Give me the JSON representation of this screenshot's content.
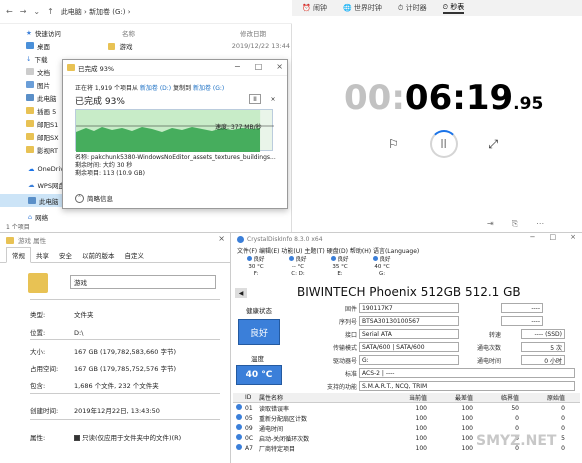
{
  "explorer": {
    "path_root": "此电脑",
    "path_drive": "新加卷 (G:)",
    "col_name": "名称",
    "col_date": "修改日期",
    "file": {
      "name": "游戏",
      "date": "2019/12/22 13:44"
    },
    "sidebar": [
      "快速访问",
      "桌面",
      "下载",
      "文档",
      "图片",
      "此电脑",
      "插画 5",
      "邮阳S1",
      "邮阳SX",
      "影视RT",
      "OneDrive",
      "WPS网盘",
      "此电脑",
      "网络"
    ],
    "status": "1 个项目"
  },
  "copy": {
    "title": "已完成 93%",
    "line1_a": "正在将 1,919 个项目从",
    "line1_src": "新加卷 (D:)",
    "line1_b": "复制到",
    "line1_dst": "新加卷 (G:)",
    "percent": "已完成 93%",
    "pause": "II",
    "close": "×",
    "speed": "速度: 377 MB/秒",
    "name": "名称: pakchunk5380-WindowsNoEditor_assets_textures_buildings...",
    "time_left": "剩余时间: 大约 30 秒",
    "items_left": "剩余项目: 113 (10.9 GB)",
    "more": "简略信息",
    "progress": 0.93
  },
  "clock": {
    "tabs": [
      "闹钟",
      "世界时钟",
      "计时器",
      "秒表"
    ],
    "time_dim": "00:",
    "time_main": "06:19",
    "time_frac": ".95",
    "flag": "⚐",
    "pause": "||",
    "expand": "⤢",
    "foot": [
      "⇥",
      "⎘",
      "⋯"
    ]
  },
  "props": {
    "title": "游戏 属性",
    "close": "×",
    "tabs": [
      "常规",
      "共享",
      "安全",
      "以前的版本",
      "自定义"
    ],
    "name": "游戏",
    "type_k": "类型:",
    "type_v": "文件夹",
    "loc_k": "位置:",
    "loc_v": "D:\\",
    "size_k": "大小:",
    "size_v": "167 GB (179,782,583,660 字节)",
    "disk_k": "占用空间:",
    "disk_v": "167 GB (179,785,752,576 字节)",
    "contains_k": "包含:",
    "contains_v": "1,686 个文件, 232 个文件夹",
    "created_k": "创建时间:",
    "created_v": "2019年12月22日, 13:43:50",
    "attr_k": "属性:",
    "attr_v": "只读(仅应用于文件夹中的文件)(R)"
  },
  "cdi": {
    "title": "CrystalDiskInfo 8.3.0 x64",
    "menu": "文件(F)  编辑(E)  功能(U)  主题(T)  硬盘(D)  帮助(H)  语言(Language)",
    "drives": [
      {
        "status": "良好",
        "temp": "30 °C",
        "letter": "F:"
      },
      {
        "status": "良好",
        "temp": "-- °C",
        "letter": "C: D:"
      },
      {
        "status": "良好",
        "temp": "35 °C",
        "letter": "E:"
      },
      {
        "status": "良好",
        "temp": "40 °C",
        "letter": "G:"
      }
    ],
    "model": "BIWINTECH Phoenix 512GB 512.1 GB",
    "health_label": "健康状态",
    "health": "良好",
    "temp_label": "温度",
    "temp": "40 °C",
    "fields": {
      "firmware_k": "固件",
      "firmware_v": "190117K7",
      "serial_k": "序列号",
      "serial_v": "BTSA30130100567",
      "iface_k": "接口",
      "iface_v": "Serial ATA",
      "mode_k": "传输模式",
      "mode_v": "SATA/600 | SATA/600",
      "letter_k": "驱动器号",
      "letter_v": "G:",
      "std_k": "标准",
      "std_v": "ACS-2 | ----",
      "feat_k": "支持的功能",
      "feat_v": "S.M.A.R.T., NCQ, TRIM",
      "r1": "----",
      "r2": "----",
      "rpm_k": "转速",
      "rpm_v": "---- (SSD)",
      "pwr_k": "通电次数",
      "pwr_v": "5 次",
      "hrs_k": "通电时间",
      "hrs_v": "0 小时"
    },
    "table_head": [
      "ID",
      "属性名称",
      "当前值",
      "最差值",
      "临界值",
      "原始值"
    ],
    "rows": [
      [
        "01",
        "读取错误率",
        "100",
        "100",
        "50",
        "0"
      ],
      [
        "05",
        "重新分配扇区计数",
        "100",
        "100",
        "0",
        "0"
      ],
      [
        "09",
        "通电时间",
        "100",
        "100",
        "0",
        "0"
      ],
      [
        "0C",
        "启动-关闭循环次数",
        "100",
        "100",
        "0",
        "5"
      ],
      [
        "A7",
        "厂商特定项目",
        "100",
        "100",
        "0",
        "0"
      ]
    ]
  },
  "watermark": "SMYZ.NET"
}
